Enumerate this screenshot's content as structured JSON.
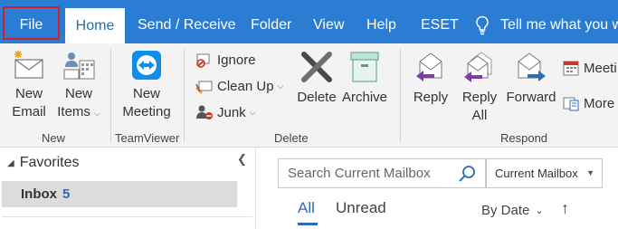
{
  "tabs": {
    "file": "File",
    "home": "Home",
    "send_receive": "Send / Receive",
    "folder": "Folder",
    "view": "View",
    "help": "Help",
    "eset": "ESET",
    "tell_me": "Tell me what you w"
  },
  "ribbon": {
    "new_group": {
      "new_email": [
        "New",
        "Email"
      ],
      "new_items": [
        "New",
        "Items"
      ],
      "label": "New"
    },
    "teamviewer_group": {
      "new_meeting": [
        "New",
        "Meeting"
      ],
      "label": "TeamViewer"
    },
    "delete_group": {
      "ignore": "Ignore",
      "clean_up": "Clean Up",
      "junk": "Junk",
      "delete": "Delete",
      "archive": "Archive",
      "label": "Delete"
    },
    "respond_group": {
      "reply": "Reply",
      "reply_all": [
        "Reply",
        "All"
      ],
      "forward": "Forward",
      "meeting": "Meeti",
      "more": "More",
      "label": "Respond"
    }
  },
  "nav": {
    "favorites": "Favorites",
    "inbox": "Inbox",
    "inbox_count": "5"
  },
  "mail": {
    "search_placeholder": "Search Current Mailbox",
    "scope": "Current Mailbox",
    "filter_all": "All",
    "filter_unread": "Unread",
    "sort_by": "By Date"
  },
  "colors": {
    "brand_blue": "#2b7cd3",
    "accent_text": "#2b6cb3",
    "file_highlight": "#d0202e"
  }
}
